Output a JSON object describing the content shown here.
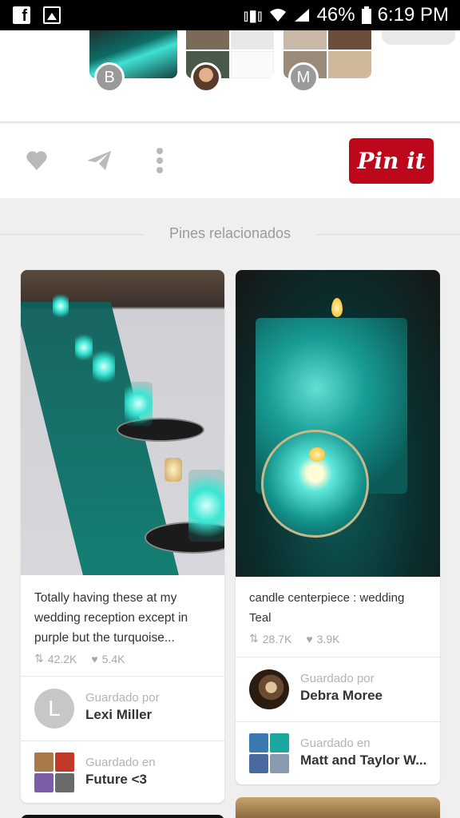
{
  "status_bar": {
    "battery": "46%",
    "time": "6:19 PM",
    "icons": [
      "facebook-icon",
      "gallery-icon",
      "vibrate-icon",
      "wifi-icon",
      "signal-icon",
      "battery-icon"
    ]
  },
  "boards": [
    {
      "avatar_letter": "B"
    },
    {
      "avatar_letter": ""
    },
    {
      "avatar_letter": "M"
    }
  ],
  "actions": {
    "pin_button": "Pin it",
    "icons": [
      "heart-icon",
      "send-icon",
      "more-icon"
    ]
  },
  "related_header": "Pines relacionados",
  "pins": [
    {
      "description": "Totally having these at my wedding reception except in purple but the turquoise...",
      "repins": "42.2K",
      "likes": "5.4K",
      "saved_by_label": "Guardado por",
      "saved_by_name": "Lexi Miller",
      "saved_by_initial": "L",
      "saved_in_label": "Guardado en",
      "saved_in_board": "Future <3"
    },
    {
      "description": "candle centerpiece :  wedding Teal",
      "repins": "28.7K",
      "likes": "3.9K",
      "saved_by_label": "Guardado por",
      "saved_by_name": "Debra Moree",
      "saved_in_label": "Guardado en",
      "saved_in_board": "Matt and Taylor W..."
    }
  ],
  "colors": {
    "pin_red": "#bd081c",
    "teal": "#1aa8a0"
  }
}
